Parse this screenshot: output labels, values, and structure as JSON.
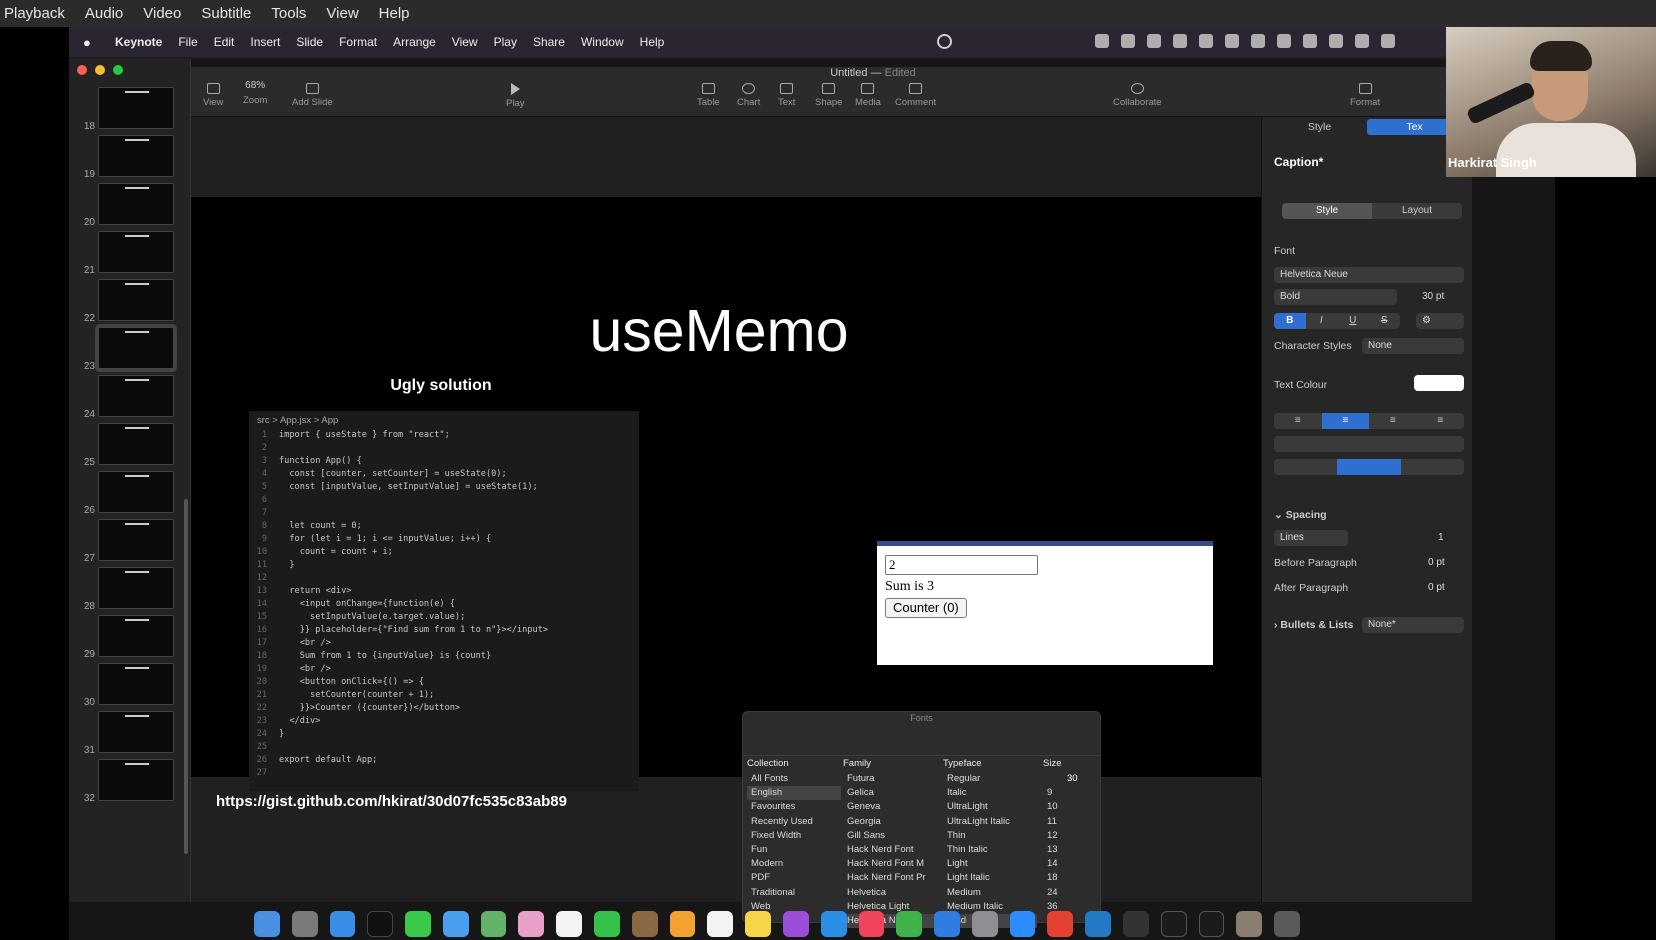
{
  "player_menu": [
    "Playback",
    "Audio",
    "Video",
    "Subtitle",
    "Tools",
    "View",
    "Help"
  ],
  "mac_menu": {
    "app": "Keynote",
    "items": [
      "File",
      "Edit",
      "Insert",
      "Slide",
      "Format",
      "Arrange",
      "View",
      "Play",
      "Share",
      "Window",
      "Help"
    ]
  },
  "window": {
    "title": "Untitled",
    "status": "Edited"
  },
  "toolbar": {
    "view": "View",
    "zoom_value": "68%",
    "zoom": "Zoom",
    "add_slide": "Add Slide",
    "play": "Play",
    "table": "Table",
    "chart": "Chart",
    "text": "Text",
    "shape": "Shape",
    "media": "Media",
    "comment": "Comment",
    "collaborate": "Collaborate",
    "format": "Format"
  },
  "slide_numbers": [
    "18",
    "19",
    "20",
    "21",
    "22",
    "23",
    "24",
    "25",
    "26",
    "27",
    "28",
    "29",
    "30",
    "31",
    "32"
  ],
  "slide": {
    "title": "useMemo",
    "subtitle": "Ugly solution",
    "breadcrumb": "src > App.jsx > App",
    "code": [
      "import { useState } from \"react\";",
      "",
      "function App() {",
      "  const [counter, setCounter] = useState(0);",
      "  const [inputValue, setInputValue] = useState(1);",
      "",
      "",
      "  let count = 0;",
      "  for (let i = 1; i <= inputValue; i++) {",
      "    count = count + i;",
      "  }",
      "",
      "  return <div>",
      "    <input onChange={function(e) {",
      "      setInputValue(e.target.value);",
      "    }} placeholder={\"Find sum from 1 to n\"}></input>",
      "    <br />",
      "    Sum from 1 to {inputValue} is {count}",
      "    <br />",
      "    <button onClick={() => {",
      "      setCounter(counter + 1);",
      "    }}>Counter ({counter})</button>",
      "  </div>",
      "}",
      "",
      "export default App;",
      ""
    ],
    "url": "https://gist.github.com/hkirat/30d07fc535c83ab89"
  },
  "browser_preview": {
    "input_value": "2",
    "sum_text": "Sum is 3",
    "button_label": "Counter (0)"
  },
  "fonts_panel": {
    "title": "Fonts",
    "headers": {
      "collection": "Collection",
      "family": "Family",
      "typeface": "Typeface",
      "size": "Size"
    },
    "collections": [
      "All Fonts",
      "English",
      "Favourites",
      "Recently Used",
      "Fixed Width",
      "Fun",
      "Modern",
      "PDF",
      "Traditional",
      "Web"
    ],
    "families": [
      "Futura",
      "Gelica",
      "Geneva",
      "Georgia",
      "Gill Sans",
      "Hack Nerd Font",
      "Hack Nerd Font M",
      "Hack Nerd Font Pr",
      "Helvetica",
      "Helvetica Light",
      "Helvetica Neue"
    ],
    "typefaces": [
      "Regular",
      "Italic",
      "UltraLight",
      "UltraLight Italic",
      "Thin",
      "Thin Italic",
      "Light",
      "Light Italic",
      "Medium",
      "Medium Italic",
      "Bold"
    ],
    "size_value": "30",
    "sizes": [
      "9",
      "10",
      "11",
      "12",
      "13",
      "14",
      "18",
      "24",
      "36"
    ]
  },
  "inspector": {
    "tab_style": "Style",
    "tab_text": "Tex",
    "paragraph_style": "Caption*",
    "sub_style": "Style",
    "sub_layout": "Layout",
    "font_label": "Font",
    "font_family": "Helvetica Neue",
    "font_weight": "Bold",
    "font_size": "30 pt",
    "b": "B",
    "i": "I",
    "u": "U",
    "s": "S",
    "char_styles_label": "Character Styles",
    "char_styles_value": "None",
    "text_colour_label": "Text Colour",
    "spacing_label": "Spacing",
    "lines_value": "Lines",
    "lines_count": "1",
    "before_paragraph_label": "Before Paragraph",
    "before_paragraph_value": "0 pt",
    "after_paragraph_label": "After Paragraph",
    "after_paragraph_value": "0 pt",
    "bullets_label": "Bullets & Lists",
    "bullets_value": "None*"
  },
  "webcam": {
    "name": "Harkirat Singh"
  },
  "colors": {
    "accent": "#2f6fd1",
    "menubar": "#2a2530",
    "slide_bg": "#000000"
  }
}
